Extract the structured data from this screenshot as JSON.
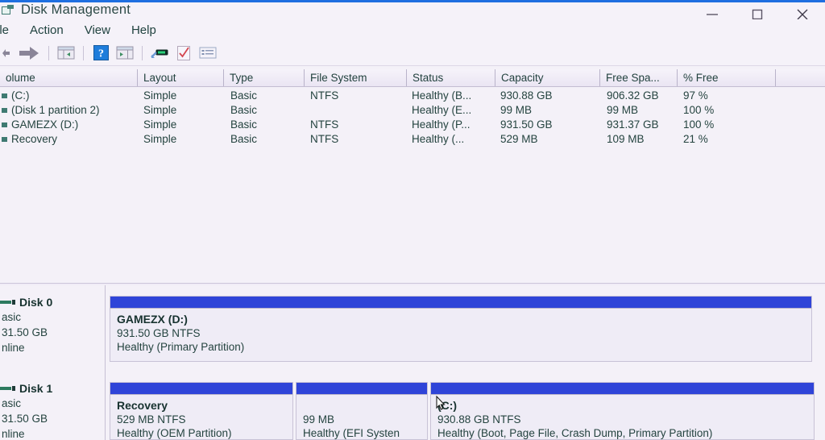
{
  "window": {
    "title": "Disk Management",
    "accent_color": "#1f6fe0",
    "minimize_label": "Minimize",
    "maximize_label": "Maximize",
    "close_label": "Close"
  },
  "menu": {
    "items": [
      {
        "label": "ile"
      },
      {
        "label": "Action"
      },
      {
        "label": "View"
      },
      {
        "label": "Help"
      }
    ]
  },
  "toolbar": {
    "items": [
      {
        "name": "back-arrow-icon",
        "tooltip": "Back"
      },
      {
        "name": "forward-arrow-icon",
        "tooltip": "Forward"
      },
      {
        "name": "show-hide-console-tree-icon",
        "tooltip": "Show/Hide Console Tree"
      },
      {
        "name": "help-icon",
        "tooltip": "Help"
      },
      {
        "name": "show-hide-action-pane-icon",
        "tooltip": "Show/Hide Action Pane"
      },
      {
        "name": "rescan-disks-icon",
        "tooltip": "Rescan Disks"
      },
      {
        "name": "properties-icon",
        "tooltip": "Properties"
      },
      {
        "name": "list-view-icon",
        "tooltip": "List View"
      }
    ]
  },
  "volume_list": {
    "columns": [
      {
        "label": "olume",
        "key": "volume"
      },
      {
        "label": "Layout",
        "key": "layout"
      },
      {
        "label": "Type",
        "key": "type"
      },
      {
        "label": "File System",
        "key": "file_system"
      },
      {
        "label": "Status",
        "key": "status"
      },
      {
        "label": "Capacity",
        "key": "capacity"
      },
      {
        "label": "Free Spa...",
        "key": "free_space"
      },
      {
        "label": "% Free",
        "key": "percent_free"
      },
      {
        "label": "",
        "key": "spacer"
      }
    ],
    "rows": [
      {
        "volume": "(C:)",
        "layout": "Simple",
        "type": "Basic",
        "file_system": "NTFS",
        "status": "Healthy (B...",
        "capacity": "930.88 GB",
        "free_space": "906.32 GB",
        "percent_free": "97 %"
      },
      {
        "volume": "(Disk 1 partition 2)",
        "layout": "Simple",
        "type": "Basic",
        "file_system": "",
        "status": "Healthy (E...",
        "capacity": "99 MB",
        "free_space": "99 MB",
        "percent_free": "100 %"
      },
      {
        "volume": "GAMEZX (D:)",
        "layout": "Simple",
        "type": "Basic",
        "file_system": "NTFS",
        "status": "Healthy (P...",
        "capacity": "931.50 GB",
        "free_space": "931.37 GB",
        "percent_free": "100 %"
      },
      {
        "volume": "Recovery",
        "layout": "Simple",
        "type": "Basic",
        "file_system": "NTFS",
        "status": "Healthy (...",
        "capacity": "529 MB",
        "free_space": "109 MB",
        "percent_free": "21 %"
      }
    ]
  },
  "disk_pane": {
    "bar_color": "#2f44d8",
    "disks": [
      {
        "name": "Disk 0",
        "type": "asic",
        "size": "31.50 GB",
        "state": "nline",
        "partitions": [
          {
            "name": "GAMEZX  (D:)",
            "size": "931.50 GB NTFS",
            "status": "Healthy (Primary Partition)"
          }
        ]
      },
      {
        "name": "Disk 1",
        "type": "asic",
        "size": "31.50 GB",
        "state": "nline",
        "partitions": [
          {
            "name": "Recovery",
            "size": "529 MB NTFS",
            "status": "Healthy (OEM Partition)"
          },
          {
            "name": "",
            "size": "99 MB",
            "status": "Healthy (EFI Systen"
          },
          {
            "name": "(C:)",
            "size": "930.88 GB NTFS",
            "status": "Healthy (Boot, Page File, Crash Dump, Primary Partition)"
          }
        ]
      }
    ]
  }
}
